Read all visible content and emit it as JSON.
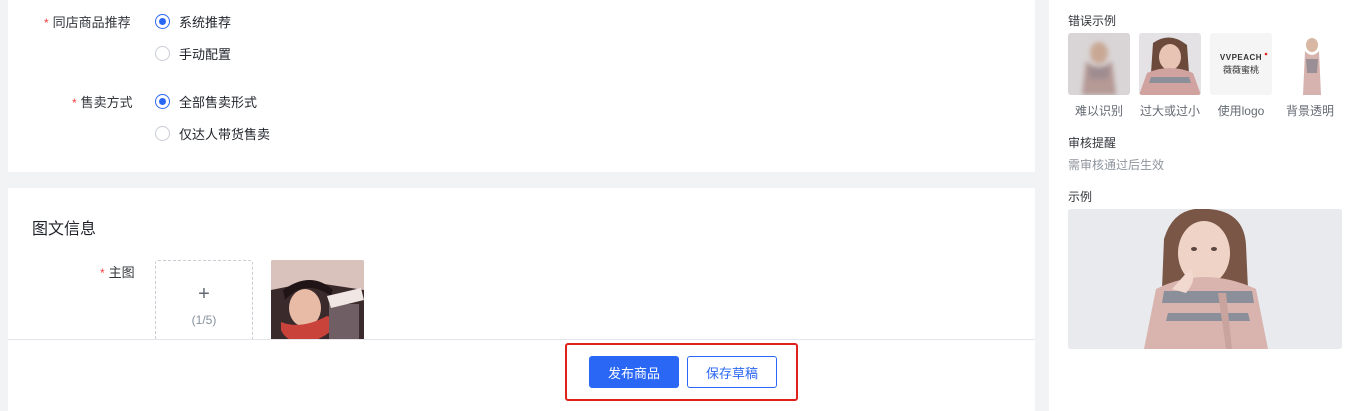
{
  "form": {
    "same_store": {
      "label": "同店商品推荐",
      "options": [
        "系统推荐",
        "手动配置"
      ],
      "selected": 0
    },
    "sale_mode": {
      "label": "售卖方式",
      "options": [
        "全部售卖形式",
        "仅达人带货售卖"
      ],
      "selected": 0
    },
    "required_mark": "*"
  },
  "image_section": {
    "title": "图文信息",
    "main_image_label": "主图",
    "upload_plus": "+",
    "upload_count": "(1/5)"
  },
  "footer": {
    "publish_label": "发布商品",
    "save_draft_label": "保存草稿",
    "highlight_color": "#e0231a"
  },
  "sidebar": {
    "wrong_examples_title": "错误示例",
    "wrong_examples": [
      {
        "caption": "难以识别"
      },
      {
        "caption": "过大或过小"
      },
      {
        "caption": "使用logo",
        "logo_text_1": "VVPEACH",
        "logo_text_2": "薇薇蜜桃"
      },
      {
        "caption": "背景透明"
      }
    ],
    "review_title": "审核提醒",
    "review_text": "需审核通过后生效",
    "example_title": "示例"
  },
  "colors": {
    "primary": "#2a67f5",
    "required": "#f53f3f"
  }
}
